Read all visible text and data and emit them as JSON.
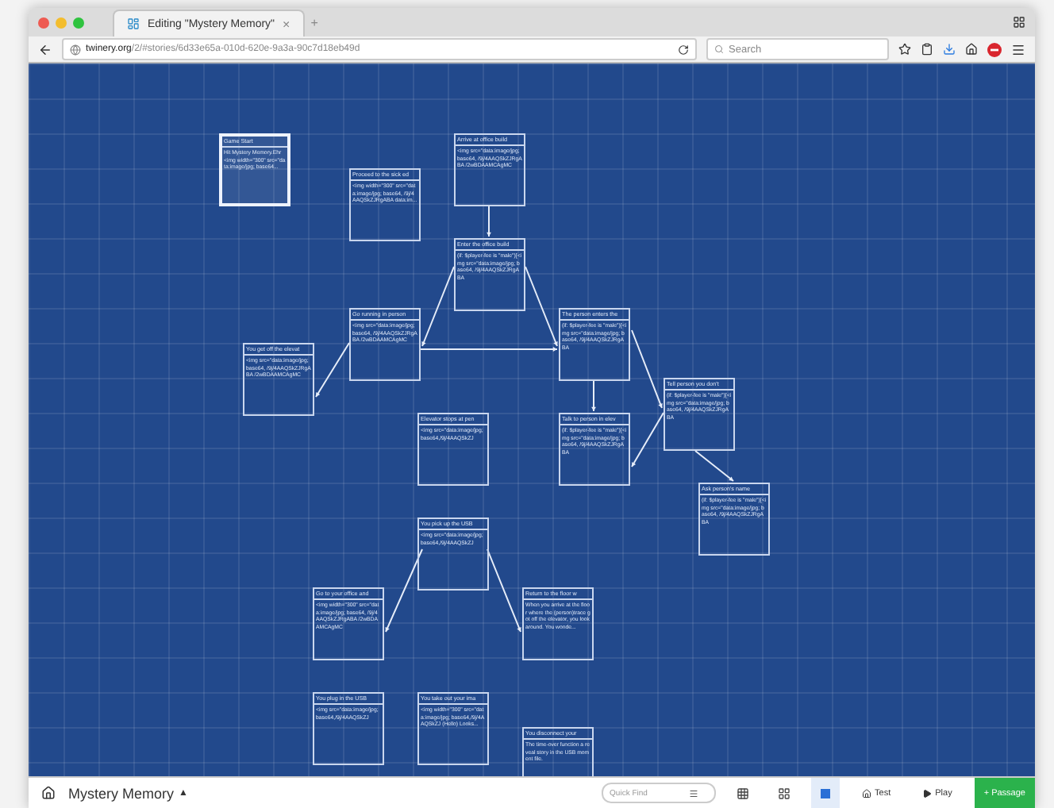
{
  "browser": {
    "tab_title": "Editing \"Mystery Memory\"",
    "tab_close": "×",
    "new_tab": "+",
    "url_host": "twinery.org",
    "url_path": "/2/#stories/6d33e65a-010d-620e-9a3a-90c7d18eb49d",
    "search_placeholder": "Search"
  },
  "passages": [
    {
      "title": "Game Start",
      "excerpt": "Hit Mystery Memory.Ehr <img width=\"300\" src=\"data:image/jpg; base64...",
      "selected": true
    },
    {
      "title": "Proceed to the sick ed",
      "excerpt": "<img width=\"300\" src=\"data:image/jpg; base64, /9j/4AAQSkZJRgABA data:im...",
      "selected": false
    },
    {
      "title": "Arrive at office build",
      "excerpt": "<img src=\"data:image/jpg; base64, /9j/4AAQSkZJRgABA /2wBDAAMCAgMC",
      "selected": false
    },
    {
      "title": "Enter the office build",
      "excerpt": "(if: $player-fee is \"male\")[<img src=\"data:image/jpg; base64, /9j/4AAQSkZJRgABA",
      "selected": false
    },
    {
      "title": "Go running in person",
      "excerpt": "<img src=\"data:image/jpg; base64, /9j/4AAQSkZJRgABA /2wBDAAMCAgMC",
      "selected": false
    },
    {
      "title": "You get off the elevat",
      "excerpt": "<img src=\"data:image/jpg; base64, /9j/4AAQSkZJRgABA /2wBDAAMCAgMC",
      "selected": false
    },
    {
      "title": "The person enters the",
      "excerpt": "(if: $player-fee is \"male\")[<img src=\"data:image/jpg; base64, /9j/4AAQSkZJRgABA",
      "selected": false
    },
    {
      "title": "Elevator stops at pen",
      "excerpt": "<img src=\"data:image/jpg; base64,/9j/4AAQSkZJ",
      "selected": false
    },
    {
      "title": "Talk to person in elev",
      "excerpt": "(if: $player-fee is \"male\")[<img src=\"data:image/jpg; base64, /9j/4AAQSkZJRgABA",
      "selected": false
    },
    {
      "title": "Tell person you don't",
      "excerpt": "(if: $player-fee is \"male\")[<img src=\"data:image/jpg; base64, /9j/4AAQSkZJRgABA",
      "selected": false
    },
    {
      "title": "Ask person's name",
      "excerpt": "(if: $player-fee is \"male\")[<img src=\"data:image/jpg; base64, /9j/4AAQSkZJRgABA",
      "selected": false
    },
    {
      "title": "You pick up the USB",
      "excerpt": "<img src=\"data:image/jpg; base64,/9j/4AAQSkZJ",
      "selected": false
    },
    {
      "title": "Go to your office and",
      "excerpt": "<img width=\"300\" src=\"data:image/jpg; base64, /9j/4AAQSkZJRgABA /2wBDAAMCAgMC",
      "selected": false
    },
    {
      "title": "Return to the floor w",
      "excerpt": "When you arrive at the floor where the (person)trace got off the elevator, you look around. You wonde...",
      "selected": false
    },
    {
      "title": "You plug in the USB",
      "excerpt": "<img src=\"data:image/jpg; base64,/9j/4AAQSkZJ",
      "selected": false
    },
    {
      "title": "You take out your ima",
      "excerpt": "<img width=\"300\" src=\"data:image/jpg; base64,/9j/4AAQSkZJ (Hello) Looks...",
      "selected": false
    },
    {
      "title": "You disconnect your",
      "excerpt": "The time-over function a reveal story in the USB moment file.",
      "selected": false
    }
  ],
  "footer": {
    "story_title": "Mystery Memory",
    "story_menu_caret": "▲",
    "quick_find_placeholder": "Quick Find",
    "zoom_levels": [
      {
        "selected": false
      },
      {
        "selected": false
      },
      {
        "selected": true
      }
    ],
    "buttons": [
      {
        "kind": "test",
        "label": "Test"
      },
      {
        "kind": "play",
        "label": "Play"
      },
      {
        "kind": "passage",
        "label": "+ Passage"
      }
    ]
  }
}
